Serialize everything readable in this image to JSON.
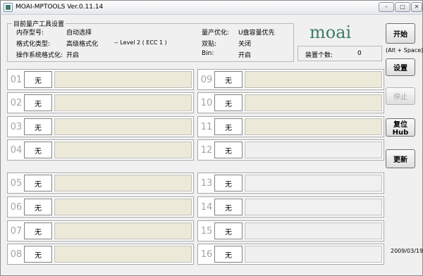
{
  "window": {
    "title": "MOAI-MPTOOLS Ver.0.11.14",
    "controls": [
      "–",
      "□",
      "✕"
    ]
  },
  "settings": {
    "legend": "目前量产工具设置",
    "memory_type_label": "内存型号:",
    "memory_type_value": "自动选择",
    "format_type_label": "格式化类型:",
    "format_type_value": "高级格式化",
    "level_value": "-- Level 2 ( ECC 1 )",
    "os_format_label": "操作系统格式化:",
    "os_format_value": "开启",
    "optimize_label": "量产优化:",
    "optimize_value": "U盘容量优先",
    "dual_label": "双贴:",
    "dual_value": "关闭",
    "bin_label": "Bin:",
    "bin_value": "开启"
  },
  "logo": {
    "text": "moai",
    "color": "#3d7c6b"
  },
  "device_count": {
    "label": "装置个数:",
    "value": "0"
  },
  "buttons": {
    "start": "开始",
    "start_hint": "(Alt + Space)",
    "settings": "设置",
    "stop": "停止",
    "reset_hub": "复位Hub",
    "update": "更新"
  },
  "ports_left": [
    {
      "num": "01",
      "status": "无",
      "state": "active"
    },
    {
      "num": "02",
      "status": "无",
      "state": "active"
    },
    {
      "num": "03",
      "status": "无",
      "state": "active"
    },
    {
      "num": "04",
      "status": "无",
      "state": "active"
    },
    {
      "num": "05",
      "status": "无",
      "state": "active"
    },
    {
      "num": "06",
      "status": "无",
      "state": "active"
    },
    {
      "num": "07",
      "status": "无",
      "state": "active"
    },
    {
      "num": "08",
      "status": "无",
      "state": "active"
    }
  ],
  "ports_right": [
    {
      "num": "09",
      "status": "无",
      "state": "active"
    },
    {
      "num": "10",
      "status": "无",
      "state": "active"
    },
    {
      "num": "11",
      "status": "无",
      "state": "active"
    },
    {
      "num": "12",
      "status": "无",
      "state": "empty"
    },
    {
      "num": "13",
      "status": "无",
      "state": "empty"
    },
    {
      "num": "14",
      "status": "无",
      "state": "empty"
    },
    {
      "num": "15",
      "status": "无",
      "state": "empty"
    },
    {
      "num": "16",
      "status": "无",
      "state": "empty"
    }
  ],
  "date": "2009/03/19",
  "colors": {
    "bar_active": "#ece9d8",
    "bar_empty": "#f0f0f0",
    "port_number": "#a4a4a4"
  }
}
